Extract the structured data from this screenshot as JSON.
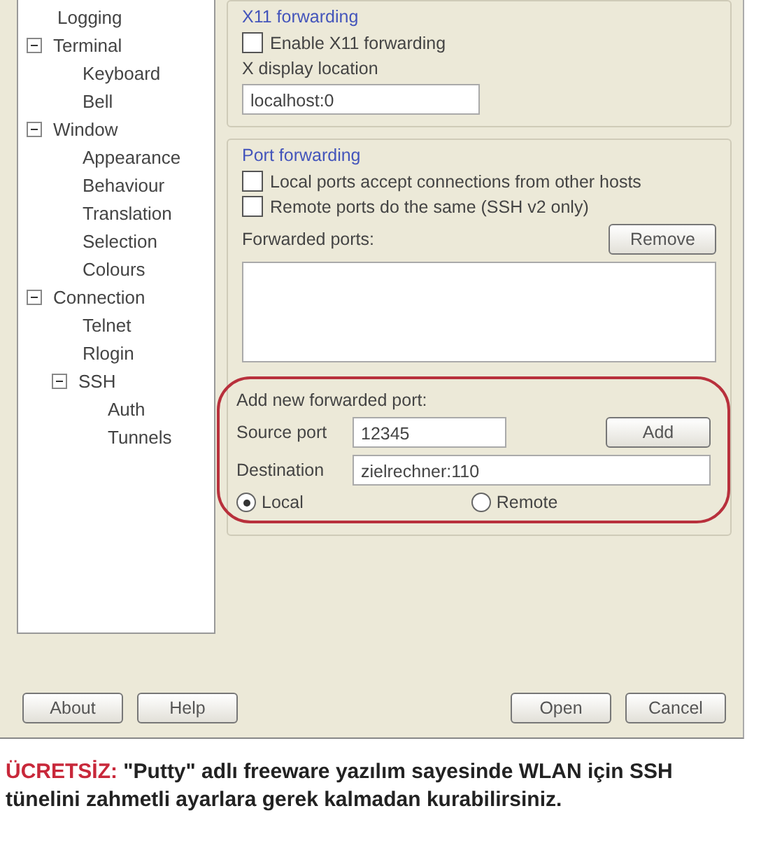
{
  "tree": [
    {
      "label": "Logging"
    },
    {
      "label": "Terminal",
      "expanded": true,
      "children": [
        {
          "label": "Keyboard"
        },
        {
          "label": "Bell"
        }
      ]
    },
    {
      "label": "Window",
      "expanded": true,
      "children": [
        {
          "label": "Appearance"
        },
        {
          "label": "Behaviour"
        },
        {
          "label": "Translation"
        },
        {
          "label": "Selection"
        },
        {
          "label": "Colours"
        }
      ]
    },
    {
      "label": "Connection",
      "expanded": true,
      "children": [
        {
          "label": "Telnet"
        },
        {
          "label": "Rlogin"
        },
        {
          "label": "SSH",
          "expanded": true,
          "children": [
            {
              "label": "Auth"
            },
            {
              "label": "Tunnels"
            }
          ]
        }
      ]
    }
  ],
  "x11": {
    "title": "X11 forwarding",
    "enable": {
      "label": "Enable X11 forwarding",
      "checked": false
    },
    "display_label": "X display location",
    "display_value": "localhost:0"
  },
  "port_forwarding": {
    "title": "Port forwarding",
    "options": [
      {
        "label": "Local ports accept connections from other hosts",
        "checked": false
      },
      {
        "label": "Remote ports do the same (SSH v2 only)",
        "checked": false
      }
    ],
    "forwarded_label": "Forwarded ports:",
    "remove_button": "Remove",
    "add_new": {
      "title": "Add new forwarded port:",
      "source_label": "Source port",
      "source_value": "12345",
      "add_button": "Add",
      "destination_label": "Destination",
      "destination_value": "zielrechner:110",
      "radios": [
        {
          "label": "Local",
          "selected": true
        },
        {
          "label": "Remote",
          "selected": false
        }
      ]
    }
  },
  "footer_left": [
    "About",
    "Help"
  ],
  "footer_right": [
    "Open",
    "Cancel"
  ],
  "caption": {
    "lead": "ÜCRETSİZ:",
    "text": "\"Putty\" adlı freeware yazılım sayesinde WLAN için SSH tünelini zahmetli ayarlara gerek kalmadan kurabilirsiniz."
  }
}
